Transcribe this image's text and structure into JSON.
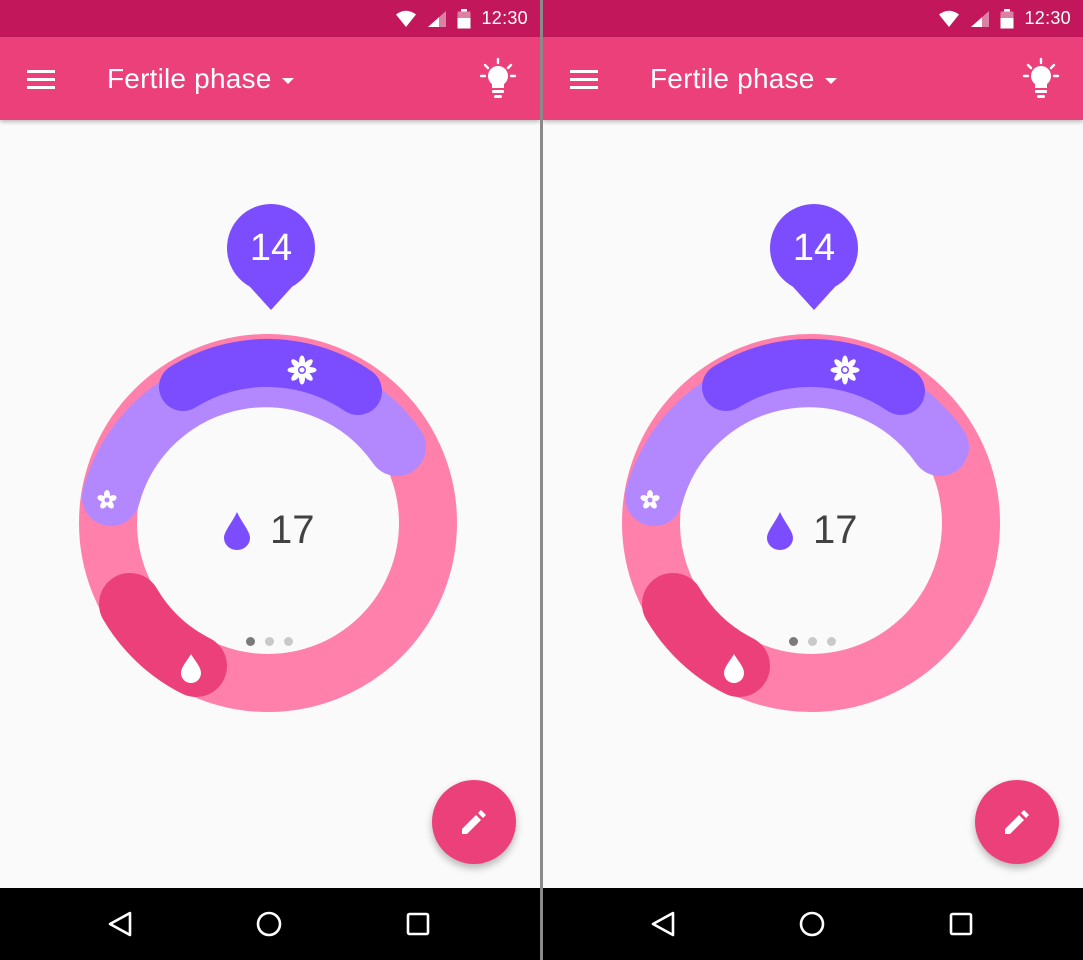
{
  "screens": [
    {
      "status_bar": {
        "time": "12:30",
        "icons": [
          "wifi-icon",
          "cell-signal-icon",
          "battery-icon"
        ]
      },
      "app_bar": {
        "title": "Fertile phase",
        "menu_icon": "menu-icon",
        "dropdown_icon": "arrow-drop-down-icon",
        "action_icon": "lightbulb-icon"
      },
      "cycle": {
        "current_day": "14",
        "center_count": "17",
        "center_icon": "drop-icon",
        "ring_markers": [
          "flower-icon",
          "flower-small-icon",
          "drop-icon"
        ],
        "pager": {
          "total": 3,
          "active": 1
        }
      },
      "fab": {
        "icon": "edit-icon"
      },
      "nav_bar": {
        "icons": [
          "back-icon",
          "home-icon",
          "recents-icon"
        ]
      }
    },
    {
      "status_bar": {
        "time": "12:30",
        "icons": [
          "wifi-icon",
          "cell-signal-icon",
          "battery-icon"
        ]
      },
      "app_bar": {
        "title": "Fertile phase",
        "menu_icon": "menu-icon",
        "dropdown_icon": "arrow-drop-down-icon",
        "action_icon": "lightbulb-icon"
      },
      "cycle": {
        "current_day": "14",
        "center_count": "17",
        "center_icon": "drop-icon",
        "ring_markers": [
          "flower-icon",
          "flower-small-icon",
          "drop-icon"
        ],
        "pager": {
          "total": 3,
          "active": 1
        }
      },
      "fab": {
        "icon": "edit-icon"
      },
      "nav_bar": {
        "icons": [
          "back-icon",
          "home-icon",
          "recents-icon"
        ]
      }
    }
  ],
  "colors": {
    "status_bar": "#c2185b",
    "app_bar": "#ec407a",
    "ring_pink": "#ff80ab",
    "ring_light_purple": "#b388ff",
    "ring_purple": "#7c4dff",
    "period_arc": "#ec407a",
    "fab": "#ec407a",
    "background": "#fafafa"
  }
}
